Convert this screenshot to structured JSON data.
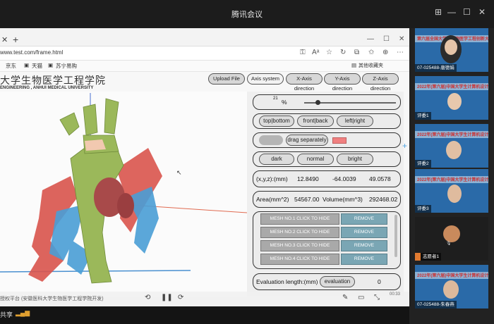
{
  "meeting": {
    "title": "腾讯会议",
    "share_label": "共享"
  },
  "browser": {
    "url": "www.test.com/frame.html",
    "bookmarks": [
      "京东",
      "天猫",
      "苏宁易购"
    ],
    "other_favorites": "其他收藏夹"
  },
  "header": {
    "logo_text": "大学生物医学工程学院",
    "logo_subtitle": "ENGINEERING , ANHUI MEDICAL UNIVERSITY",
    "buttons": [
      "Upload File",
      "Axis system",
      "X-Axis direction",
      "Y-Axis direction",
      "Z-Axis direction"
    ]
  },
  "panel": {
    "opacity_value": "21",
    "opacity_unit": "%",
    "view_buttons": [
      "top|bottom",
      "front|back",
      "left|right"
    ],
    "drag_label": "drag separately",
    "swatch_color": "#f08080",
    "theme_buttons": [
      "dark",
      "normal",
      "bright"
    ],
    "coords_label": "(x,y,z):(mm)",
    "coords": [
      "12.8490",
      "-64.0039",
      "49.0578"
    ],
    "area_label": "Area(mm^2)",
    "area_value": "54567.00",
    "volume_label": "Volume(mm^3)",
    "volume_value": "292468.02",
    "meshes": [
      {
        "hide": "MESH NO.1 CLICK TO HIDE",
        "remove": "REMOVE"
      },
      {
        "hide": "MESH NO.2 CLICK TO HIDE",
        "remove": "REMOVE"
      },
      {
        "hide": "MESH NO.3 CLICK TO HIDE",
        "remove": "REMOVE"
      },
      {
        "hide": "MESH NO.4 CLICK TO HIDE",
        "remove": "REMOVE"
      }
    ],
    "eval_label": "Evaluation length:(mm)",
    "eval_button": "evaluation",
    "eval_value": "0"
  },
  "video": {
    "footer_text": "授权平台 (安徽医科大学生物医学工程学院开发)",
    "time_display": "00:33"
  },
  "participants": [
    {
      "name": "07-025488-唐德娟",
      "banner": "第六届全国大学生生物医学工程创新大赛"
    },
    {
      "name": "评委1",
      "banner": "2022年(第六届)中国大学生计算机设计大赛"
    },
    {
      "name": "评委2",
      "banner": "2022年(第六届)中国大学生计算机设计大赛"
    },
    {
      "name": "评委3",
      "banner": "2022年(第六届)中国大学生计算机设计大赛"
    },
    {
      "name": "志愿者1",
      "banner": ""
    },
    {
      "name": "07-025488-朱春燕",
      "banner": "2022年(第六届)中国大学生计算机设计大赛"
    }
  ]
}
